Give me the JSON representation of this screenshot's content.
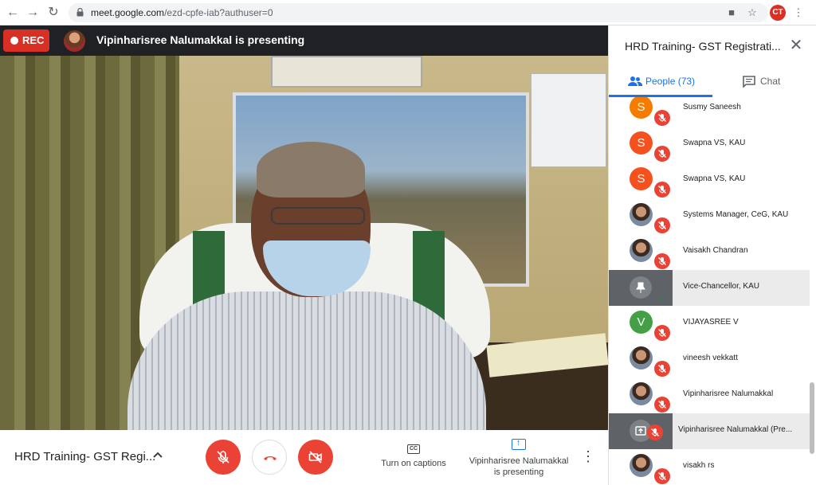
{
  "browser": {
    "url_host": "meet.google.com",
    "url_path": "/ezd-cpfe-iab?authuser=0",
    "profile_initials": "CT"
  },
  "meeting": {
    "rec_label": "REC",
    "presenting_banner": "Vipinharisree Nalumakkal is presenting",
    "title": "HRD Training- GST Regi...",
    "captions_label": "Turn on captions",
    "captions_icon_text": "CC",
    "presenter_label_line1": "Vipinharisree Nalumakkal",
    "presenter_label_line2": "is presenting"
  },
  "panel": {
    "title": "HRD Training- GST Registrati...",
    "people_tab": "People (73)",
    "chat_tab": "Chat",
    "people": [
      {
        "name": "Susmy Saneesh",
        "initial": "S",
        "color": "#f57c00",
        "avatar": "letter"
      },
      {
        "name": "Swapna VS, KAU",
        "initial": "S",
        "color": "#f4511e",
        "avatar": "letter"
      },
      {
        "name": "Swapna VS, KAU",
        "initial": "S",
        "color": "#f4511e",
        "avatar": "letter"
      },
      {
        "name": "Systems Manager, CeG, KAU",
        "initial": "",
        "color": "",
        "avatar": "photo"
      },
      {
        "name": "Vaisakh Chandran",
        "initial": "",
        "color": "",
        "avatar": "photo"
      },
      {
        "name": "Vice-Chancellor, KAU",
        "initial": "",
        "color": "",
        "avatar": "tile-pin"
      },
      {
        "name": "VIJAYASREE V",
        "initial": "V",
        "color": "#43a047",
        "avatar": "letter"
      },
      {
        "name": "vineesh vekkatt",
        "initial": "",
        "color": "",
        "avatar": "photo"
      },
      {
        "name": "Vipinharisree Nalumakkal",
        "initial": "",
        "color": "",
        "avatar": "photo"
      },
      {
        "name": "Vipinharisree Nalumakkal (Pre...",
        "initial": "",
        "color": "",
        "avatar": "tile-present"
      },
      {
        "name": "visakh rs",
        "initial": "",
        "color": "",
        "avatar": "photo"
      }
    ]
  },
  "colors": {
    "accent": "#1a73e8",
    "danger": "#ea4335",
    "rec": "#d93025"
  }
}
